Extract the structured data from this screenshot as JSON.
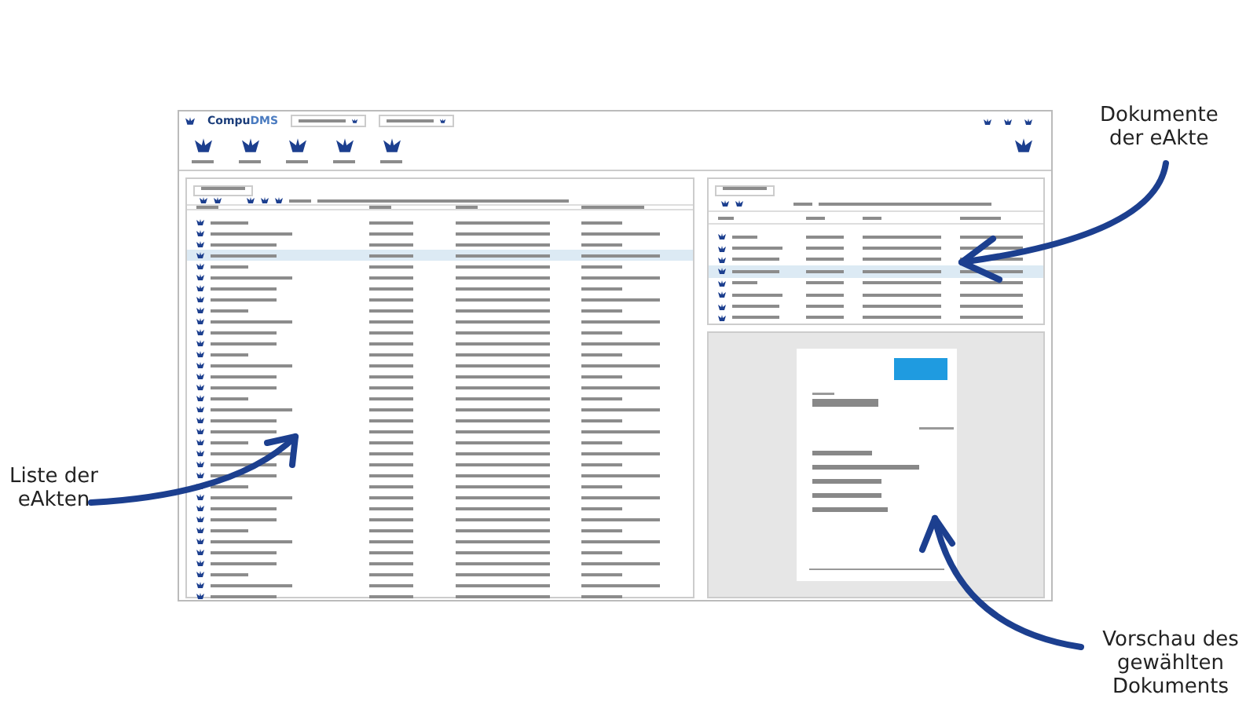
{
  "window": {
    "title": "**Compu**DMS"
  },
  "left_list": {
    "rows": [
      {
        "selected": false
      },
      {
        "selected": false
      },
      {
        "selected": false
      },
      {
        "selected": true
      },
      {
        "selected": false
      },
      {
        "selected": false
      },
      {
        "selected": false
      },
      {
        "selected": false
      },
      {
        "selected": false
      },
      {
        "selected": false
      },
      {
        "selected": false
      },
      {
        "selected": false
      },
      {
        "selected": false
      },
      {
        "selected": false
      },
      {
        "selected": false
      },
      {
        "selected": false
      },
      {
        "selected": false
      },
      {
        "selected": false
      },
      {
        "selected": false
      },
      {
        "selected": false
      },
      {
        "selected": false
      },
      {
        "selected": false
      },
      {
        "selected": false
      },
      {
        "selected": false
      },
      {
        "selected": false
      },
      {
        "selected": false
      },
      {
        "selected": false
      },
      {
        "selected": false
      },
      {
        "selected": false
      },
      {
        "selected": false
      },
      {
        "selected": false
      },
      {
        "selected": false
      },
      {
        "selected": false
      },
      {
        "selected": false
      },
      {
        "selected": false
      }
    ]
  },
  "document_list": {
    "rows": [
      {
        "selected": false
      },
      {
        "selected": false
      },
      {
        "selected": false
      },
      {
        "selected": true
      },
      {
        "selected": false
      },
      {
        "selected": false
      },
      {
        "selected": false
      },
      {
        "selected": false
      }
    ]
  },
  "annotations": [
    {
      "kind": "documents",
      "text": "Dokumente\nder eAkte"
    },
    {
      "kind": "list",
      "text": "Liste der\neAkten"
    },
    {
      "kind": "preview",
      "text": "Vorschau des\ngewählten Dokuments"
    }
  ]
}
